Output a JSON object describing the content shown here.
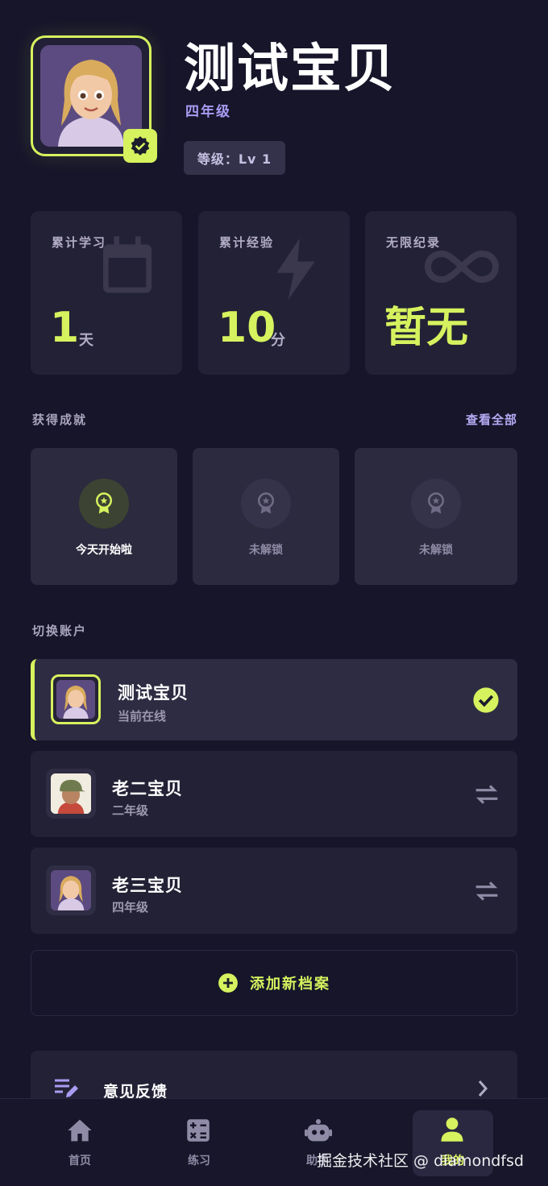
{
  "profile": {
    "name": "测试宝贝",
    "grade": "四年级",
    "level": "等级：Lv 1"
  },
  "stats": [
    {
      "label": "累计学习",
      "value": "1",
      "unit": "天",
      "icon": "calendar-icon"
    },
    {
      "label": "累计经验",
      "value": "10",
      "unit": "分",
      "icon": "lightning-icon"
    },
    {
      "label": "无限纪录",
      "value": "暂无",
      "unit": "",
      "icon": "infinity-icon"
    }
  ],
  "achievements": {
    "title": "获得成就",
    "see_all": "查看全部",
    "items": [
      {
        "label": "今天开始啦",
        "unlocked": true
      },
      {
        "label": "未解锁",
        "unlocked": false
      },
      {
        "label": "未解锁",
        "unlocked": false
      }
    ]
  },
  "accounts": {
    "title": "切换账户",
    "items": [
      {
        "name": "测试宝贝",
        "sub": "当前在线",
        "active": true
      },
      {
        "name": "老二宝贝",
        "sub": "二年级",
        "active": false
      },
      {
        "name": "老三宝贝",
        "sub": "四年级",
        "active": false
      }
    ],
    "add_label": "添加新档案"
  },
  "menu": {
    "feedback": "意见反馈"
  },
  "nav": [
    {
      "label": "首页",
      "icon": "home-icon"
    },
    {
      "label": "练习",
      "icon": "calculator-icon"
    },
    {
      "label": "助手",
      "icon": "robot-icon"
    },
    {
      "label": "我的",
      "icon": "person-icon"
    }
  ],
  "watermark": "掘金技术社区 @ diamondfsd",
  "colors": {
    "background": "#16152a",
    "card": "#232135",
    "accent": "#d6f25e",
    "purple": "#a99bf2"
  }
}
